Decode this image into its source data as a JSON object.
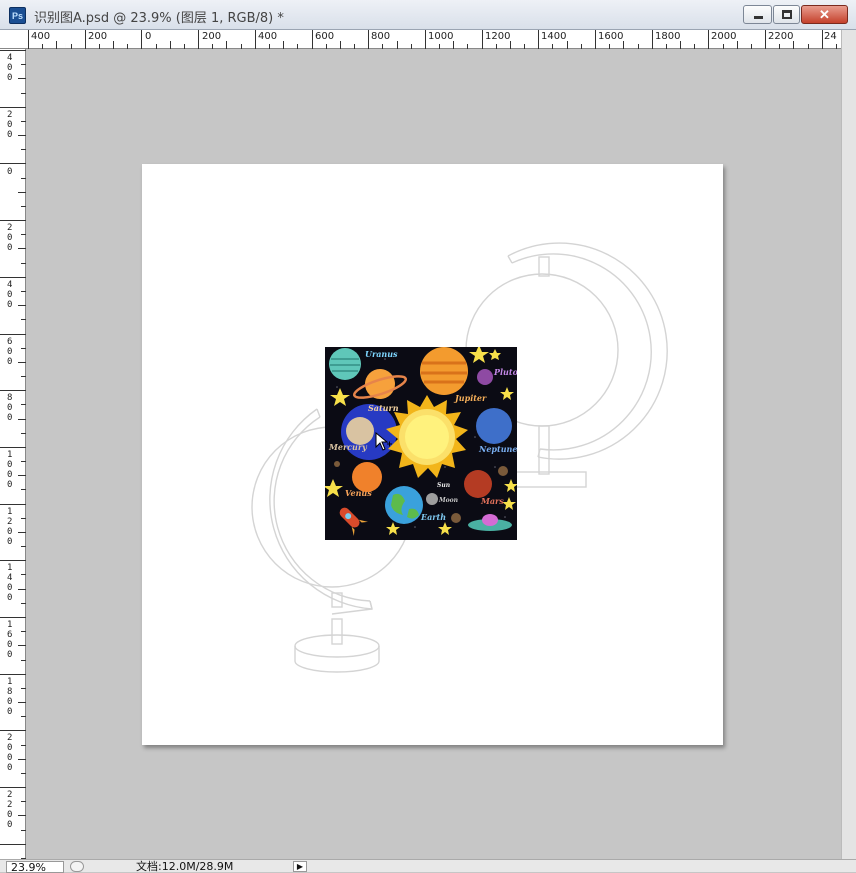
{
  "window": {
    "app_icon_label": "Ps",
    "title": "识别图A.psd @ 23.9% (图层 1, RGB/8) *",
    "close_label": "✕"
  },
  "ruler_top_labels": [
    "400",
    "200",
    "0",
    "200",
    "400",
    "600",
    "800",
    "1000",
    "1200",
    "1400",
    "1600",
    "1800",
    "2000",
    "2200",
    "24"
  ],
  "ruler_left_labels": [
    "400",
    "200",
    "0",
    "200",
    "400",
    "600",
    "800",
    "1000",
    "1200",
    "1400",
    "1600",
    "1800",
    "2000",
    "2200"
  ],
  "image": {
    "labels": [
      "Uranus",
      "Pluto",
      "Saturn",
      "Jupiter",
      "Mercury",
      "Neptune",
      "Venus",
      "Sun",
      "Moon",
      "Mars",
      "Earth"
    ]
  },
  "status": {
    "zoom": "23.9%",
    "doc_info": "文档:12.0M/28.9M"
  },
  "icons": [
    "photoshop-app-icon",
    "minimize-icon",
    "maximize-icon",
    "close-icon",
    "move-cursor-icon",
    "scroll-right-arrow-icon",
    "status-info-icon"
  ]
}
